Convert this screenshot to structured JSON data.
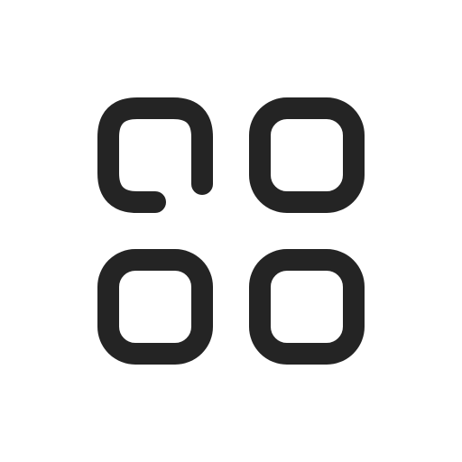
{
  "icon": {
    "name": "apps-grid-icon",
    "stroke_color": "#242424",
    "background": "#ffffff",
    "tiles": [
      {
        "name": "tile-top-left-open-icon",
        "style": "open-corner"
      },
      {
        "name": "tile-top-right-icon",
        "style": "rounded-square"
      },
      {
        "name": "tile-bottom-left-icon",
        "style": "rounded-square"
      },
      {
        "name": "tile-bottom-right-icon",
        "style": "rounded-square"
      }
    ]
  }
}
